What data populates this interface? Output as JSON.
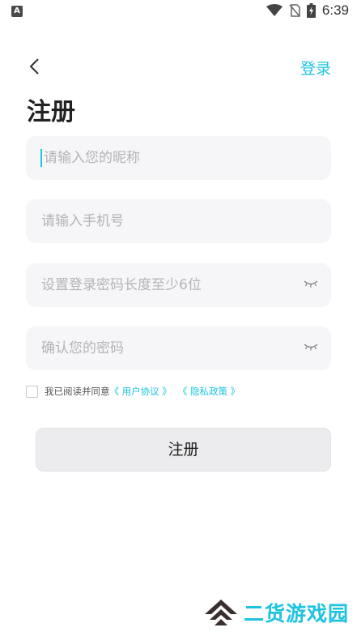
{
  "status_bar": {
    "time": "6:39",
    "left_icon": "A"
  },
  "header": {
    "back_icon": "chevron-left-icon",
    "login_label": "登录"
  },
  "title": "注册",
  "form": {
    "nickname_placeholder": "请输入您的昵称",
    "phone_placeholder": "请输入手机号",
    "password_placeholder": "设置登录密码长度至少6位",
    "confirm_placeholder": "确认您的密码"
  },
  "agreement": {
    "prefix": "我已阅读并同意",
    "user_agreement": "《 用户协议 》",
    "privacy_policy": "《 隐私政策 》"
  },
  "submit_label": "注册",
  "watermark": "二货游戏园",
  "colors": {
    "accent": "#1ec3e0",
    "field_bg": "#f6f5f7",
    "button_bg": "#ececee"
  }
}
